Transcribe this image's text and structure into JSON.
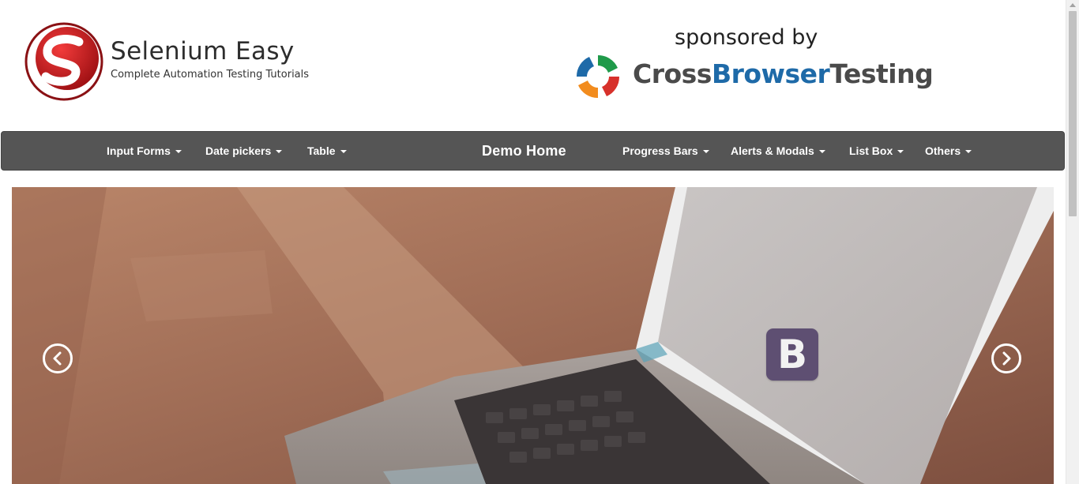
{
  "brand": {
    "title": "Selenium Easy",
    "tagline": "Complete Automation Testing Tutorials",
    "logo_icon": "selenium-easy-s-logo"
  },
  "sponsor": {
    "label": "sponsored by",
    "name_part1": "Cross",
    "name_part2": "Browser",
    "name_part3": "Testing",
    "logo_icon": "crossbrowsertesting-logo",
    "colors": {
      "dark": "#4a4a4a",
      "blue": "#1e6aa8",
      "green": "#1f9a4a",
      "orange": "#f28c1e",
      "red": "#d7312b"
    }
  },
  "nav": {
    "items": [
      {
        "label": "Input Forms",
        "dropdown": true
      },
      {
        "label": "Date pickers",
        "dropdown": true
      },
      {
        "label": "Table",
        "dropdown": true
      },
      {
        "label": "Demo Home",
        "dropdown": false
      },
      {
        "label": "Progress Bars",
        "dropdown": true
      },
      {
        "label": "Alerts & Modals",
        "dropdown": true
      },
      {
        "label": "List Box",
        "dropdown": true
      },
      {
        "label": "Others",
        "dropdown": true
      }
    ],
    "background": "#555555"
  },
  "carousel": {
    "slide_icon": "bootstrap-logo",
    "slide_logo_text": "B",
    "prev_icon": "chevron-left-icon",
    "next_icon": "chevron-right-icon"
  }
}
